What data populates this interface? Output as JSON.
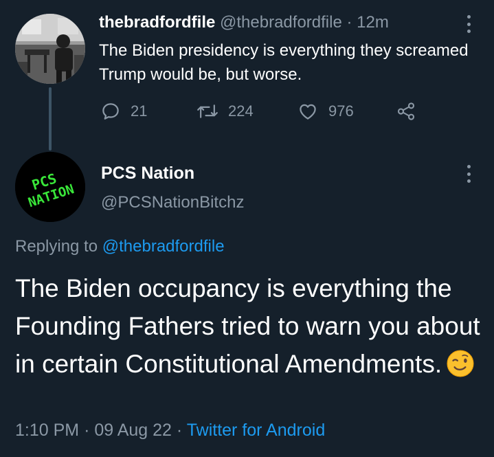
{
  "parent_tweet": {
    "display_name": "thebradfordfile",
    "handle": "@thebradfordfile",
    "separator": "·",
    "time": "12m",
    "text": "The Biden presidency is everything they screamed Trump would be, but worse.",
    "actions": {
      "reply_count": "21",
      "retweet_count": "224",
      "like_count": "976"
    }
  },
  "reply_tweet": {
    "display_name": "PCS Nation",
    "handle": "@PCSNationBitchz",
    "replying_prefix": "Replying to",
    "replying_to": "@thebradfordfile",
    "text": "The Biden occupancy is everything the Founding Fathers tried to warn you about in certain Constitutional Amendments.",
    "meta": {
      "time": "1:10 PM",
      "separator1": "·",
      "date": "09 Aug 22",
      "separator2": "·",
      "source": "Twitter for Android"
    },
    "avatar_text": "PCS NATION"
  },
  "colors": {
    "background": "#15202b",
    "primary_text": "#ffffff",
    "secondary_text": "#8b98a5",
    "link": "#1d9bf0",
    "avatar_green": "#39e639"
  },
  "icons": [
    "reply-icon",
    "retweet-icon",
    "like-icon",
    "share-icon",
    "more-options-icon",
    "wink-emoji-icon"
  ]
}
